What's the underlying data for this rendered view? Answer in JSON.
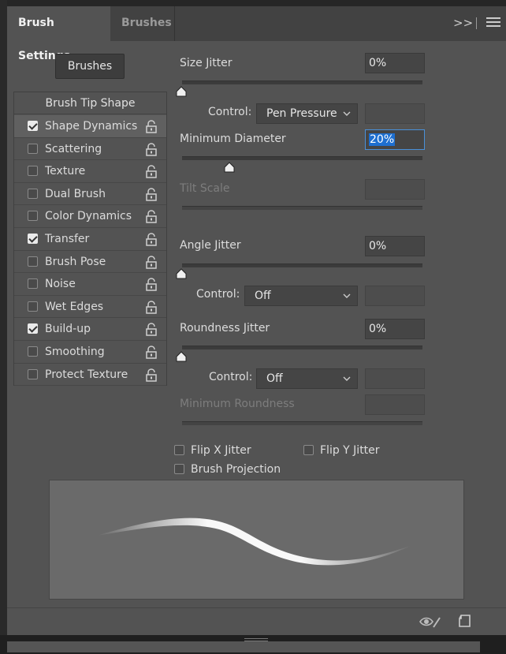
{
  "tabs": [
    {
      "label": "Brush Settings",
      "active": true
    },
    {
      "label": "Brushes",
      "active": false
    }
  ],
  "header": {
    "collapse_glyph": ">>"
  },
  "brushes_button": "Brushes",
  "brush_tip_shape": "Brush Tip Shape",
  "options": [
    {
      "label": "Shape Dynamics",
      "checked": true,
      "selected": true
    },
    {
      "label": "Scattering",
      "checked": false
    },
    {
      "label": "Texture",
      "checked": false
    },
    {
      "label": "Dual Brush",
      "checked": false
    },
    {
      "label": "Color Dynamics",
      "checked": false
    },
    {
      "label": "Transfer",
      "checked": true
    },
    {
      "label": "Brush Pose",
      "checked": false
    },
    {
      "label": "Noise",
      "checked": false
    },
    {
      "label": "Wet Edges",
      "checked": false
    },
    {
      "label": "Build-up",
      "checked": true
    },
    {
      "label": "Smoothing",
      "checked": false
    },
    {
      "label": "Protect Texture",
      "checked": false
    }
  ],
  "settings": {
    "size_jitter": {
      "label": "Size Jitter",
      "value": "0%",
      "slider": 0
    },
    "size_control": {
      "label": "Control:",
      "value": "Pen Pressure"
    },
    "min_diameter": {
      "label": "Minimum Diameter",
      "value": "20%",
      "slider": 0.2
    },
    "tilt_scale": {
      "label": "Tilt Scale",
      "value": ""
    },
    "angle_jitter": {
      "label": "Angle Jitter",
      "value": "0%",
      "slider": 0
    },
    "angle_control": {
      "label": "Control:",
      "value": "Off"
    },
    "roundness_jitter": {
      "label": "Roundness Jitter",
      "value": "0%",
      "slider": 0
    },
    "roundness_control": {
      "label": "Control:",
      "value": "Off"
    },
    "min_roundness": {
      "label": "Minimum Roundness",
      "value": ""
    }
  },
  "flip_x": {
    "label": "Flip X Jitter",
    "checked": false
  },
  "flip_y": {
    "label": "Flip Y Jitter",
    "checked": false
  },
  "brush_projection": {
    "label": "Brush Projection",
    "checked": false
  },
  "colors": {
    "panel": "#535353",
    "tabbar": "#424242",
    "highlight": "#1e6fd0"
  },
  "footer_icons": [
    "eye-brush-icon",
    "new-preset-icon"
  ]
}
